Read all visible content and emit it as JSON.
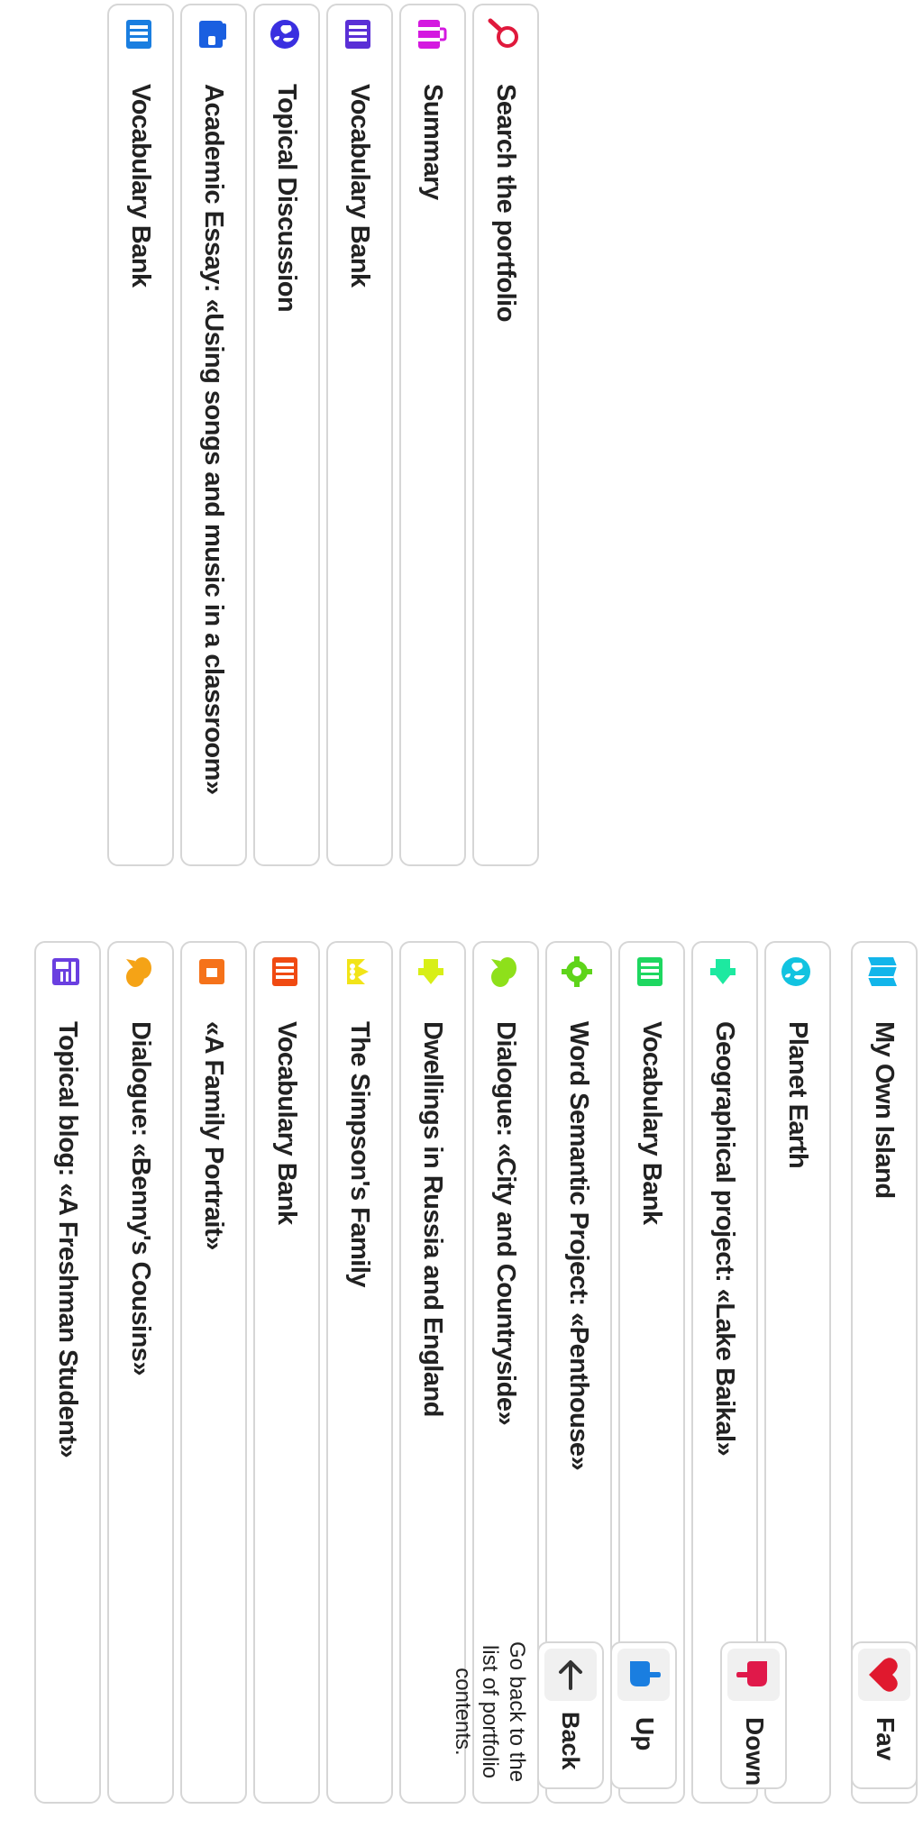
{
  "portfolio_items": [
    {
      "label": "My Own Island",
      "icon": "map-icon",
      "color": "#12b5ea"
    },
    {
      "label": "Planet Earth",
      "icon": "globe-icon",
      "color": "#12c3e0"
    },
    {
      "label": "Geographical project: «Lake Baikal»",
      "icon": "puzzle-icon",
      "color": "#1de9a0"
    },
    {
      "label": "Vocabulary Bank",
      "icon": "book-icon",
      "color": "#1ed760"
    },
    {
      "label": "Word Semantic Project: «Penthouse»",
      "icon": "gear-icon",
      "color": "#5ed41a"
    },
    {
      "label": "Dialogue: «City and Countryside»",
      "icon": "chat-icon",
      "color": "#8ee01a"
    },
    {
      "label": "Dwellings in Russia and England",
      "icon": "puzzle-icon",
      "color": "#d8ef16"
    },
    {
      "label": "The Simpson's Family",
      "icon": "crown-icon",
      "color": "#f2e418"
    },
    {
      "label": "Vocabulary Bank",
      "icon": "book-icon",
      "color": "#f04a12"
    },
    {
      "label": "«A Family Portrait»",
      "icon": "portrait-icon",
      "color": "#f5721a"
    },
    {
      "label": "Dialogue: «Benny's Cousins»",
      "icon": "chat-icon",
      "color": "#f5a316"
    },
    {
      "label": "Topical blog: «A Freshman Student»",
      "icon": "blog-icon",
      "color": "#6a3fe0"
    }
  ],
  "tools": [
    {
      "label": "Search the portfolio",
      "icon": "search-icon",
      "color": "#e0193c"
    },
    {
      "label": "Summary",
      "icon": "briefcase-icon",
      "color": "#d419e0"
    },
    {
      "label": "Vocabulary Bank",
      "icon": "book-icon",
      "color": "#5a2fd6"
    },
    {
      "label": "Topical Discussion",
      "icon": "globe-icon",
      "color": "#3a2fe0"
    },
    {
      "label": "Academic Essay: «Using songs and music in a classroom»",
      "icon": "wallet-icon",
      "color": "#1a5fe0"
    },
    {
      "label": "Vocabulary Bank",
      "icon": "book-icon",
      "color": "#1a7ee0"
    }
  ],
  "nav": {
    "fav_label": "Fav",
    "down_label": "Down",
    "up_label": "Up",
    "back_label": "Back",
    "back_help": "Go back to the list of portfolio contents.",
    "fav_color": "#e0192e",
    "down_color": "#e0194a",
    "up_color": "#1a7ee0"
  }
}
